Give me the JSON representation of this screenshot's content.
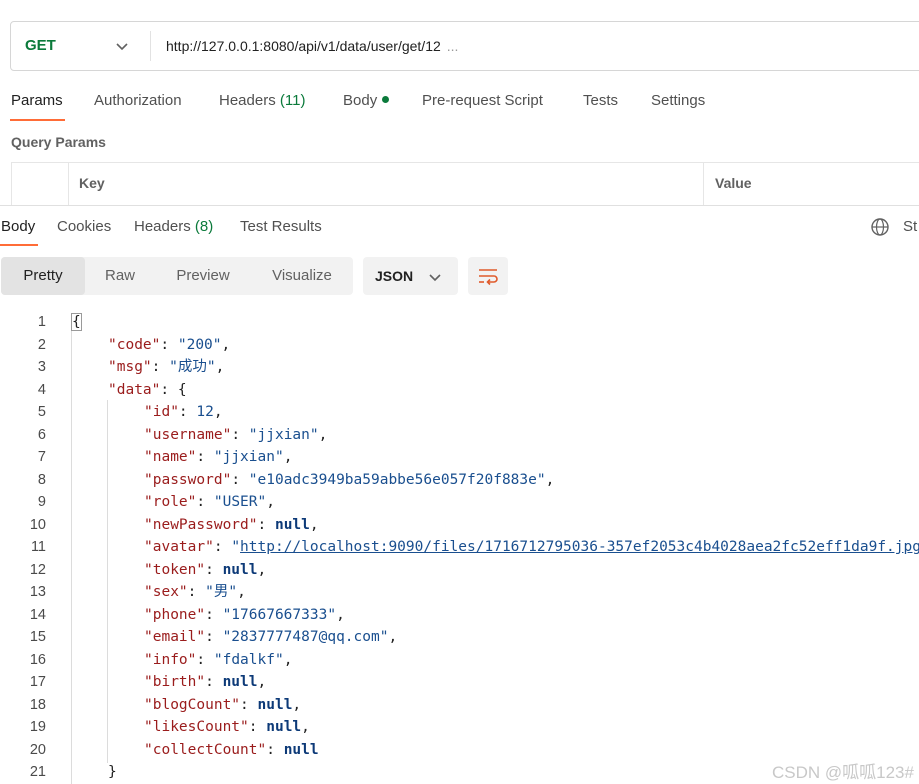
{
  "request": {
    "method": "GET",
    "url": "http://127.0.0.1:8080/api/v1/data/user/get/12",
    "url_ellipsis": "..."
  },
  "request_tabs": [
    {
      "label": "Params",
      "active": true
    },
    {
      "label": "Authorization"
    },
    {
      "label": "Headers",
      "count": "(11)"
    },
    {
      "label": "Body",
      "has_dot": true
    },
    {
      "label": "Pre-request Script"
    },
    {
      "label": "Tests"
    },
    {
      "label": "Settings"
    }
  ],
  "query_params": {
    "title": "Query Params",
    "columns": [
      "Key",
      "Value"
    ]
  },
  "response_tabs": [
    {
      "label": "Body",
      "active": true
    },
    {
      "label": "Cookies"
    },
    {
      "label": "Headers",
      "count": "(8)"
    },
    {
      "label": "Test Results"
    }
  ],
  "response_status_partial": "St",
  "format": {
    "buttons": [
      "Pretty",
      "Raw",
      "Preview",
      "Visualize"
    ],
    "active": "Pretty",
    "language": "JSON"
  },
  "code_lines": [
    {
      "n": "1",
      "indent": 0,
      "tokens": [
        {
          "t": "p",
          "v": "{"
        }
      ]
    },
    {
      "n": "2",
      "indent": 1,
      "tokens": [
        {
          "t": "k",
          "v": "\"code\""
        },
        {
          "t": "p",
          "v": ": "
        },
        {
          "t": "s",
          "v": "\"200\""
        },
        {
          "t": "p",
          "v": ","
        }
      ]
    },
    {
      "n": "3",
      "indent": 1,
      "tokens": [
        {
          "t": "k",
          "v": "\"msg\""
        },
        {
          "t": "p",
          "v": ": "
        },
        {
          "t": "s",
          "v": "\"成功\""
        },
        {
          "t": "p",
          "v": ","
        }
      ]
    },
    {
      "n": "4",
      "indent": 1,
      "tokens": [
        {
          "t": "k",
          "v": "\"data\""
        },
        {
          "t": "p",
          "v": ": {"
        }
      ]
    },
    {
      "n": "5",
      "indent": 2,
      "tokens": [
        {
          "t": "k",
          "v": "\"id\""
        },
        {
          "t": "p",
          "v": ": "
        },
        {
          "t": "n",
          "v": "12"
        },
        {
          "t": "p",
          "v": ","
        }
      ]
    },
    {
      "n": "6",
      "indent": 2,
      "tokens": [
        {
          "t": "k",
          "v": "\"username\""
        },
        {
          "t": "p",
          "v": ": "
        },
        {
          "t": "s",
          "v": "\"jjxian\""
        },
        {
          "t": "p",
          "v": ","
        }
      ]
    },
    {
      "n": "7",
      "indent": 2,
      "tokens": [
        {
          "t": "k",
          "v": "\"name\""
        },
        {
          "t": "p",
          "v": ": "
        },
        {
          "t": "s",
          "v": "\"jjxian\""
        },
        {
          "t": "p",
          "v": ","
        }
      ]
    },
    {
      "n": "8",
      "indent": 2,
      "tokens": [
        {
          "t": "k",
          "v": "\"password\""
        },
        {
          "t": "p",
          "v": ": "
        },
        {
          "t": "s",
          "v": "\"e10adc3949ba59abbe56e057f20f883e\""
        },
        {
          "t": "p",
          "v": ","
        }
      ]
    },
    {
      "n": "9",
      "indent": 2,
      "tokens": [
        {
          "t": "k",
          "v": "\"role\""
        },
        {
          "t": "p",
          "v": ": "
        },
        {
          "t": "s",
          "v": "\"USER\""
        },
        {
          "t": "p",
          "v": ","
        }
      ]
    },
    {
      "n": "10",
      "indent": 2,
      "tokens": [
        {
          "t": "k",
          "v": "\"newPassword\""
        },
        {
          "t": "p",
          "v": ": "
        },
        {
          "t": "kw",
          "v": "null"
        },
        {
          "t": "p",
          "v": ","
        }
      ]
    },
    {
      "n": "11",
      "indent": 2,
      "tokens": [
        {
          "t": "k",
          "v": "\"avatar\""
        },
        {
          "t": "p",
          "v": ": "
        },
        {
          "t": "s",
          "v": "\""
        },
        {
          "t": "link",
          "v": "http://localhost:9090/files/1716712795036-357ef2053c4b4028aea2fc52eff1da9f.jpg"
        }
      ]
    },
    {
      "n": "12",
      "indent": 2,
      "tokens": [
        {
          "t": "k",
          "v": "\"token\""
        },
        {
          "t": "p",
          "v": ": "
        },
        {
          "t": "kw",
          "v": "null"
        },
        {
          "t": "p",
          "v": ","
        }
      ]
    },
    {
      "n": "13",
      "indent": 2,
      "tokens": [
        {
          "t": "k",
          "v": "\"sex\""
        },
        {
          "t": "p",
          "v": ": "
        },
        {
          "t": "s",
          "v": "\"男\""
        },
        {
          "t": "p",
          "v": ","
        }
      ]
    },
    {
      "n": "14",
      "indent": 2,
      "tokens": [
        {
          "t": "k",
          "v": "\"phone\""
        },
        {
          "t": "p",
          "v": ": "
        },
        {
          "t": "s",
          "v": "\"17667667333\""
        },
        {
          "t": "p",
          "v": ","
        }
      ]
    },
    {
      "n": "15",
      "indent": 2,
      "tokens": [
        {
          "t": "k",
          "v": "\"email\""
        },
        {
          "t": "p",
          "v": ": "
        },
        {
          "t": "s",
          "v": "\"2837777487@qq.com\""
        },
        {
          "t": "p",
          "v": ","
        }
      ]
    },
    {
      "n": "16",
      "indent": 2,
      "tokens": [
        {
          "t": "k",
          "v": "\"info\""
        },
        {
          "t": "p",
          "v": ": "
        },
        {
          "t": "s",
          "v": "\"fdalkf\""
        },
        {
          "t": "p",
          "v": ","
        }
      ]
    },
    {
      "n": "17",
      "indent": 2,
      "tokens": [
        {
          "t": "k",
          "v": "\"birth\""
        },
        {
          "t": "p",
          "v": ": "
        },
        {
          "t": "kw",
          "v": "null"
        },
        {
          "t": "p",
          "v": ","
        }
      ]
    },
    {
      "n": "18",
      "indent": 2,
      "tokens": [
        {
          "t": "k",
          "v": "\"blogCount\""
        },
        {
          "t": "p",
          "v": ": "
        },
        {
          "t": "kw",
          "v": "null"
        },
        {
          "t": "p",
          "v": ","
        }
      ]
    },
    {
      "n": "19",
      "indent": 2,
      "tokens": [
        {
          "t": "k",
          "v": "\"likesCount\""
        },
        {
          "t": "p",
          "v": ": "
        },
        {
          "t": "kw",
          "v": "null"
        },
        {
          "t": "p",
          "v": ","
        }
      ]
    },
    {
      "n": "20",
      "indent": 2,
      "tokens": [
        {
          "t": "k",
          "v": "\"collectCount\""
        },
        {
          "t": "p",
          "v": ": "
        },
        {
          "t": "kw",
          "v": "null"
        }
      ]
    },
    {
      "n": "21",
      "indent": 1,
      "tokens": [
        {
          "t": "p",
          "v": "}"
        }
      ]
    }
  ],
  "watermark": "CSDN @呱呱123#",
  "colors": {
    "accent": "#ff6c37",
    "method": "#0b7a3b",
    "json_key": "#9a1c1c",
    "json_string": "#1a4f8f"
  }
}
